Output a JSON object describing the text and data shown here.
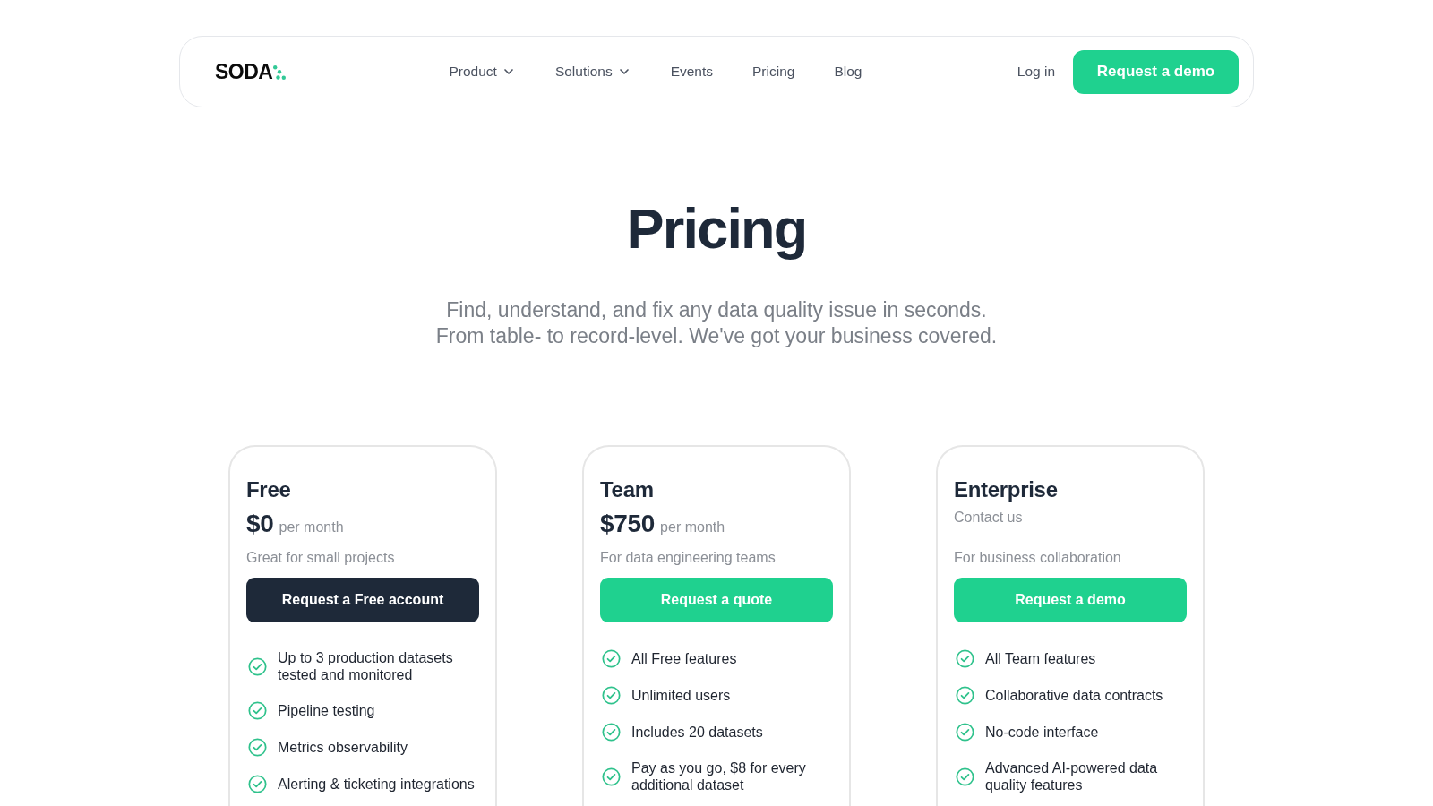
{
  "nav": {
    "logo": "SODA",
    "links": [
      {
        "label": "Product",
        "dropdown": true
      },
      {
        "label": "Solutions",
        "dropdown": true
      },
      {
        "label": "Events",
        "dropdown": false
      },
      {
        "label": "Pricing",
        "dropdown": false
      },
      {
        "label": "Blog",
        "dropdown": false
      }
    ],
    "login": "Log in",
    "cta": "Request a demo"
  },
  "hero": {
    "title": "Pricing",
    "subtitle": [
      "Find, understand, and fix any data quality issue in seconds.",
      "From table- to record-level. We've got your business covered."
    ]
  },
  "plans": [
    {
      "name": "Free",
      "price": {
        "kind": "amount",
        "amount": "$0",
        "period": "per month"
      },
      "tagline": "Great for small projects",
      "button": {
        "label": "Request a Free account",
        "kind": "dark"
      },
      "features": [
        "Up to 3 production datasets tested and monitored",
        "Pipeline testing",
        "Metrics observability",
        "Alerting & ticketing integrations"
      ]
    },
    {
      "name": "Team",
      "price": {
        "kind": "amount",
        "amount": "$750",
        "period": "per month"
      },
      "tagline": "For data engineering teams",
      "button": {
        "label": "Request a quote",
        "kind": "primary"
      },
      "features": [
        "All Free features",
        "Unlimited users",
        "Includes 20 datasets",
        "Pay as you go, $8 for every additional dataset"
      ]
    },
    {
      "name": "Enterprise",
      "price": {
        "kind": "contact",
        "text": "Contact us"
      },
      "tagline": "For business collaboration",
      "button": {
        "label": "Request a demo",
        "kind": "primary"
      },
      "features": [
        "All Team features",
        "Collaborative data contracts",
        "No-code interface",
        "Advanced AI-powered data quality features"
      ]
    }
  ]
}
